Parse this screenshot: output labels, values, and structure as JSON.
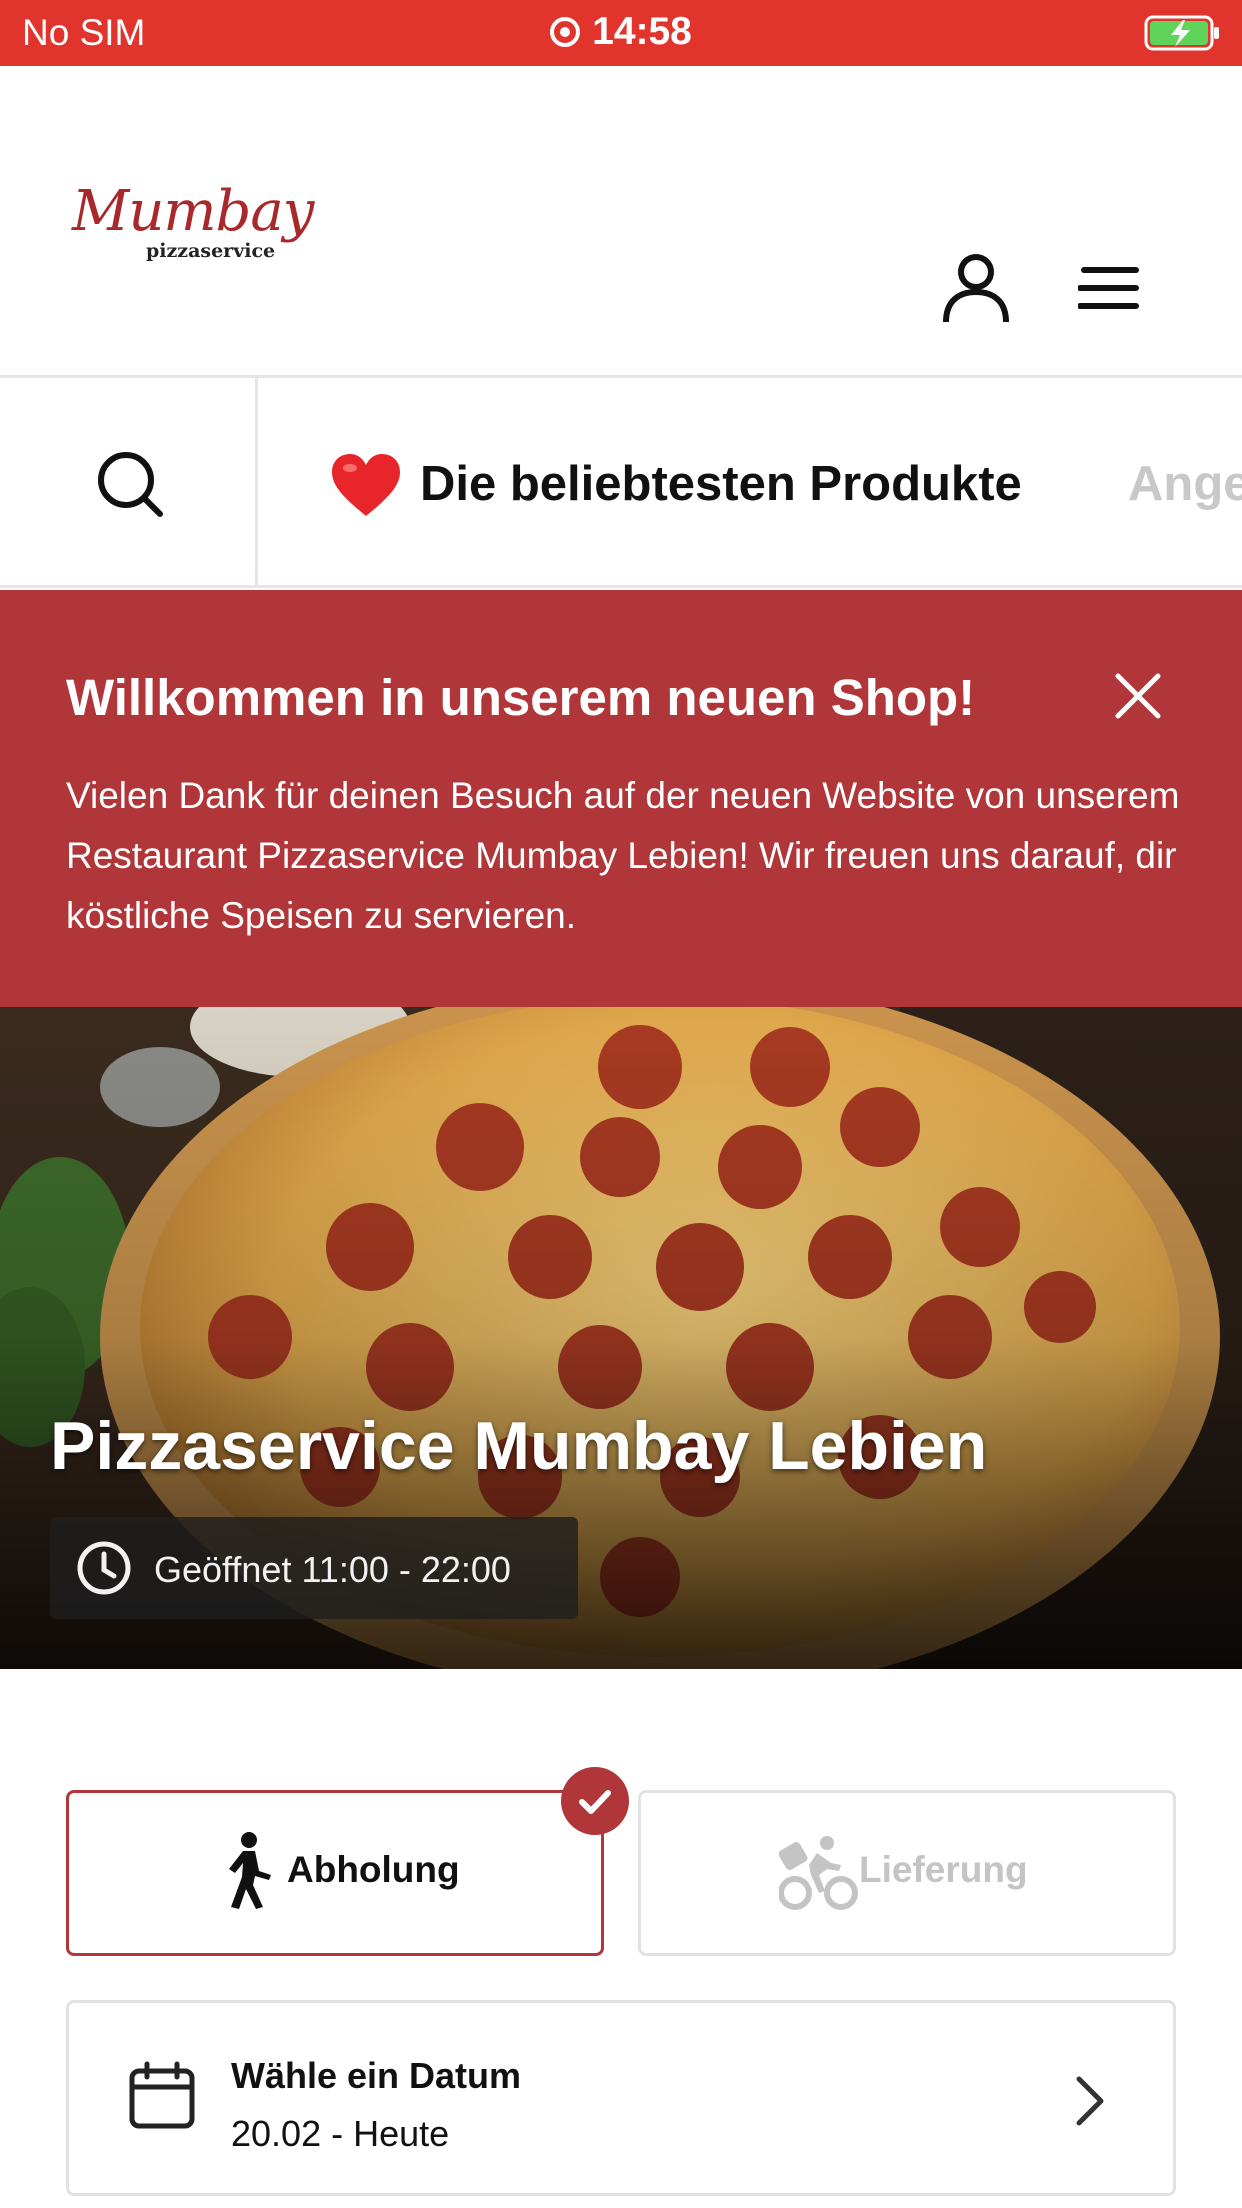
{
  "status_bar": {
    "carrier": "No SIM",
    "time": "14:58"
  },
  "header": {
    "logo_script": "Mumbay",
    "logo_sub": "pizzaservice"
  },
  "categories": {
    "active": "Die beliebtesten Produkte",
    "next": "Ange"
  },
  "banner": {
    "title": "Willkommen in unserem neuen Shop!",
    "body": "Vielen Dank für deinen Besuch auf der neuen Website von unserem Restaurant Pizzaservice Mumbay Lebien! Wir freuen uns darauf, dir köstliche Speisen zu servieren."
  },
  "hero": {
    "restaurant_name": "Pizzaservice Mumbay Lebien",
    "hours": "Geöffnet 11:00 - 22:00"
  },
  "order_type": {
    "pickup_label": "Abholung",
    "delivery_label": "Lieferung",
    "selected": "Abholung"
  },
  "date_picker": {
    "label": "Wähle ein Datum",
    "value": "20.02 - Heute"
  },
  "colors": {
    "status_bar": "#e0342c",
    "brand_red": "#b1363a",
    "disabled_text": "#c4c4c4"
  }
}
